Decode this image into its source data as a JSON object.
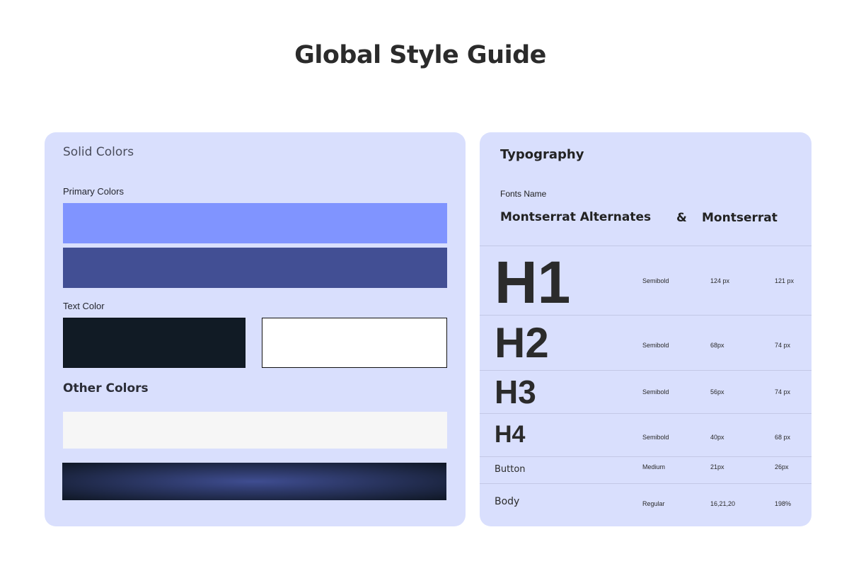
{
  "page": {
    "title": "Global Style Guide"
  },
  "colors_card": {
    "title": "Solid Colors",
    "primary_label": "Primary Colors",
    "primary_swatches": [
      "#8094ff",
      "#424f94"
    ],
    "text_label": "Text Color",
    "text_swatches": [
      "#111b25",
      "#ffffff"
    ],
    "other_title": "Other Colors",
    "other_swatches": {
      "light": "#f6f6f6",
      "gradient_center": "#3f4d91",
      "gradient_edge": "#0f1724"
    }
  },
  "typography_card": {
    "title": "Typography",
    "fonts_label": "Fonts Name",
    "font_primary": "Montserrat Alternates",
    "ampersand": "&",
    "font_secondary": "Montserrat",
    "rows": [
      {
        "sample": "H1",
        "weight": "Semibold",
        "size": "124 px",
        "line_height": "121 px"
      },
      {
        "sample": "H2",
        "weight": "Semibold",
        "size": "68px",
        "line_height": "74 px"
      },
      {
        "sample": "H3",
        "weight": "Semibold",
        "size": "56px",
        "line_height": "74 px"
      },
      {
        "sample": "H4",
        "weight": "Semibold",
        "size": "40px",
        "line_height": "68 px"
      },
      {
        "sample": "Button",
        "weight": "Medium",
        "size": "21px",
        "line_height": "26px"
      },
      {
        "sample": "Body",
        "weight": "Regular",
        "size": "16,21,20",
        "line_height": "198%"
      }
    ]
  }
}
